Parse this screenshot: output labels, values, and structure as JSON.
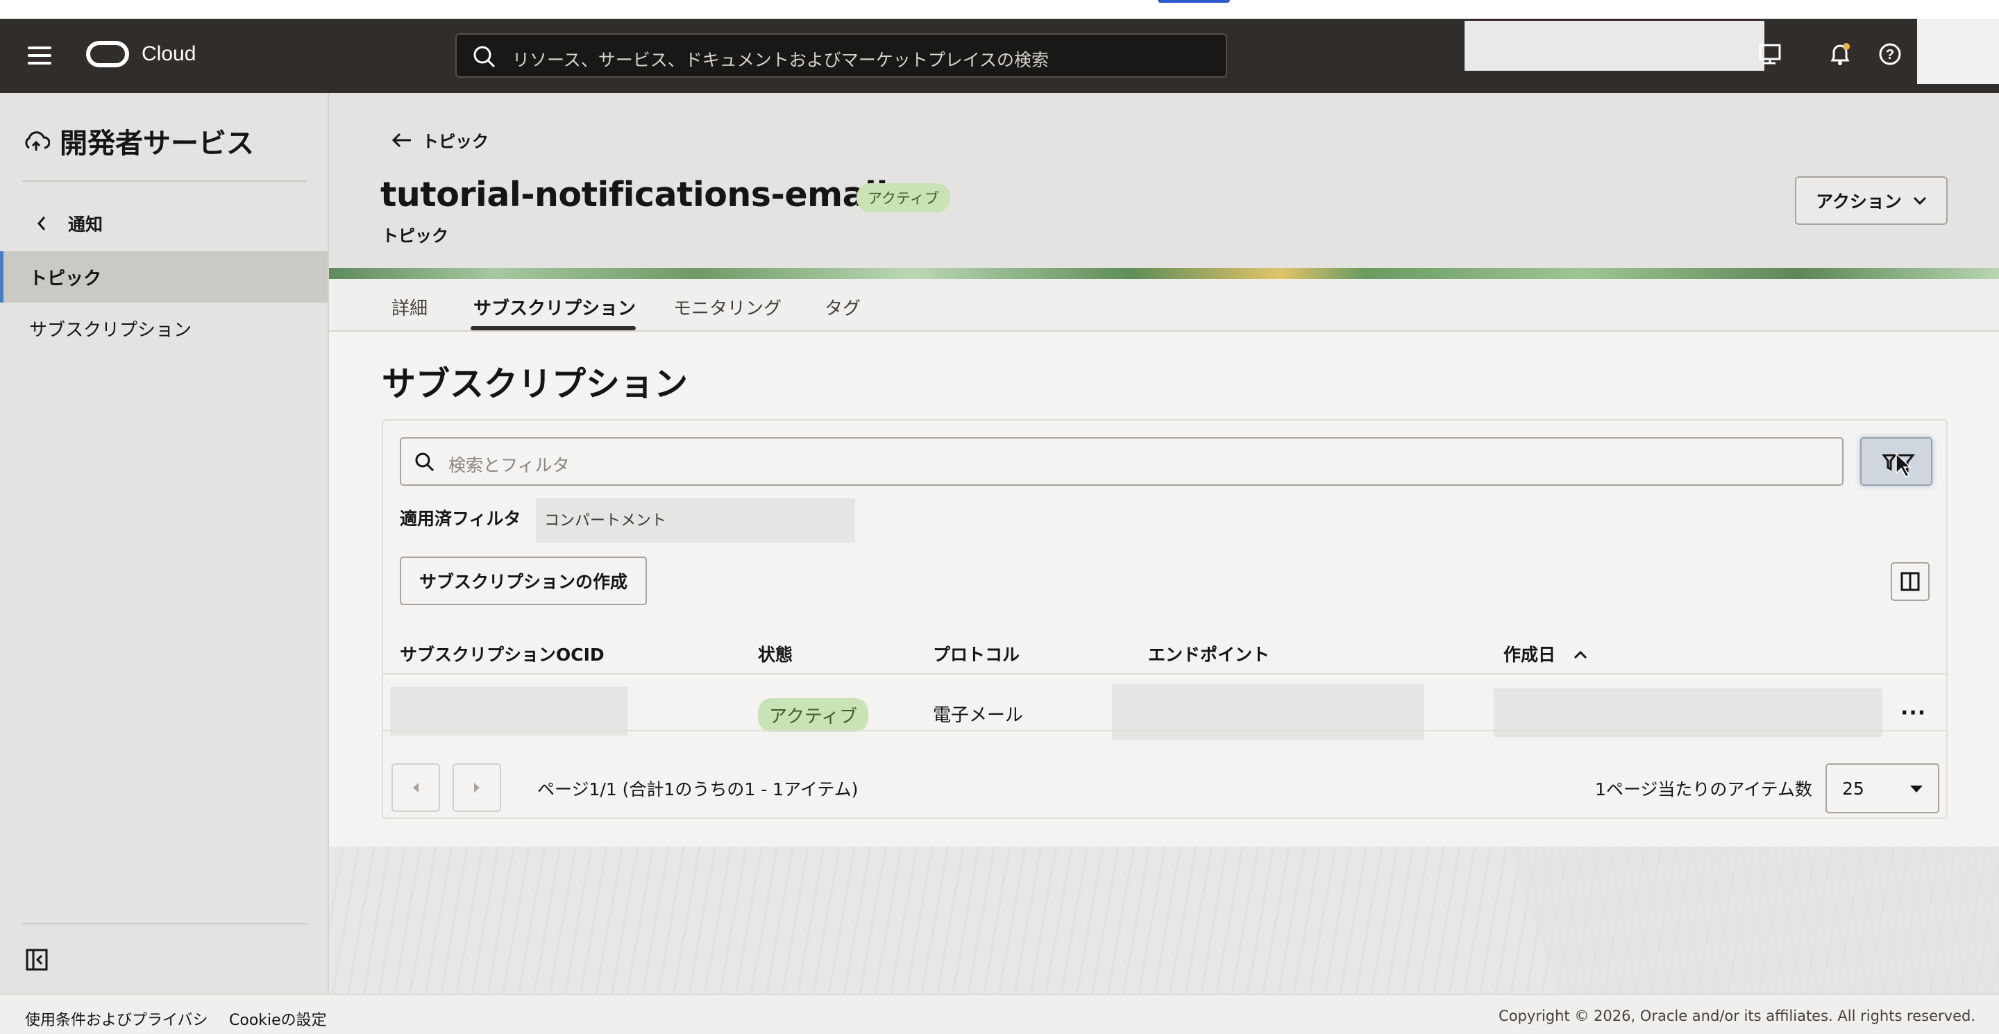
{
  "header": {
    "brand": "Cloud",
    "search_placeholder": "リソース、サービス、ドキュメントおよびマーケットプレイスの検索"
  },
  "sidebar": {
    "title": "開発者サービス",
    "back_label": "通知",
    "items": [
      {
        "label": "トピック",
        "active": true
      },
      {
        "label": "サブスクリプション",
        "active": false
      }
    ]
  },
  "page": {
    "breadcrumb": "トピック",
    "title": "tutorial-notifications-email",
    "status_badge": "アクティブ",
    "subtitle": "トピック",
    "action_button": "アクション"
  },
  "tabs": [
    {
      "label": "詳細",
      "active": false
    },
    {
      "label": "サブスクリプション",
      "active": true
    },
    {
      "label": "モニタリング",
      "active": false
    },
    {
      "label": "タグ",
      "active": false
    }
  ],
  "section": {
    "title": "サブスクリプション",
    "filter_placeholder": "検索とフィルタ",
    "applied_filters_label": "適用済フィルタ",
    "filter_chip": "コンパートメント",
    "create_button": "サブスクリプションの作成"
  },
  "table": {
    "columns": [
      "サブスクリプションOCID",
      "状態",
      "プロトコル",
      "エンドポイント",
      "作成日"
    ],
    "rows": [
      {
        "ocid": "",
        "state": "アクティブ",
        "protocol": "電子メール",
        "endpoint": "",
        "created": ""
      }
    ],
    "more_actions": "···"
  },
  "pagination": {
    "summary": "ページ1/1 (合計1のうちの1 - 1アイテム)",
    "per_page_label": "1ページ当たりのアイテム数",
    "per_page_value": "25"
  },
  "footer": {
    "terms": "使用条件およびプライバシ",
    "cookies": "Cookieの設定",
    "copyright": "Copyright © 2026, Oracle and/or its affiliates. All rights reserved."
  },
  "colors": {
    "header_bg": "#312d2a",
    "badge_bg": "#c9e2b6",
    "active_nav_bg": "#cbc9c6"
  }
}
